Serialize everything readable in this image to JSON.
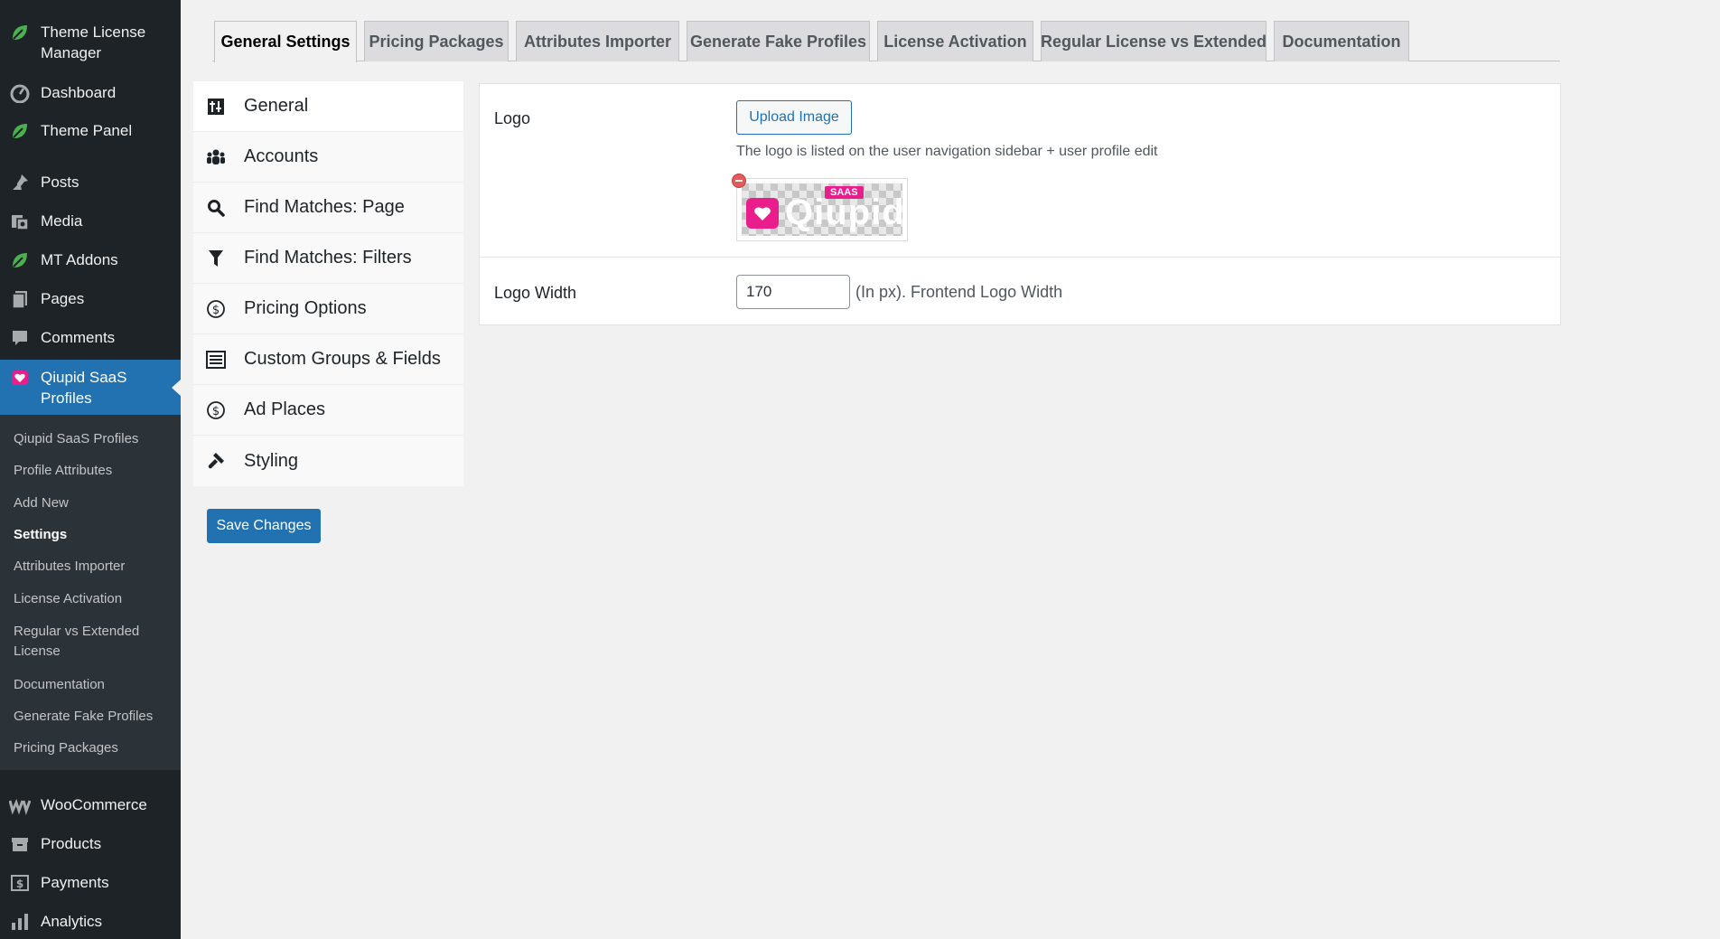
{
  "sidebar": {
    "items": [
      {
        "label": "Theme License Manager",
        "icon": "leaf-icon"
      },
      {
        "label": "Dashboard",
        "icon": "dashboard-icon"
      },
      {
        "label": "Theme Panel",
        "icon": "leaf-icon"
      },
      {
        "label": "Posts",
        "icon": "pin-icon"
      },
      {
        "label": "Media",
        "icon": "media-icon"
      },
      {
        "label": "MT Addons",
        "icon": "leaf-icon"
      },
      {
        "label": "Pages",
        "icon": "pages-icon"
      },
      {
        "label": "Comments",
        "icon": "comment-icon"
      },
      {
        "label": "Qiupid SaaS Profiles",
        "icon": "heart-icon"
      },
      {
        "label": "WooCommerce",
        "icon": "woocommerce-icon"
      },
      {
        "label": "Products",
        "icon": "archive-icon"
      },
      {
        "label": "Payments",
        "icon": "dollar-icon"
      },
      {
        "label": "Analytics",
        "icon": "bar-chart-icon"
      }
    ],
    "submenu": [
      "Qiupid SaaS Profiles",
      "Profile Attributes",
      "Add New",
      "Settings",
      "Attributes Importer",
      "License Activation",
      "Regular vs Extended License",
      "Documentation",
      "Generate Fake Profiles",
      "Pricing Packages"
    ]
  },
  "tabs": [
    "General Settings",
    "Pricing Packages",
    "Attributes Importer",
    "Generate Fake Profiles",
    "License Activation",
    "Regular License vs Extended",
    "Documentation"
  ],
  "sections": [
    {
      "label": "General",
      "icon": "sliders-icon"
    },
    {
      "label": "Accounts",
      "icon": "users-icon"
    },
    {
      "label": "Find Matches: Page",
      "icon": "search-icon"
    },
    {
      "label": "Find Matches: Filters",
      "icon": "filter-icon"
    },
    {
      "label": "Pricing Options",
      "icon": "dollar-circle-icon"
    },
    {
      "label": "Custom Groups & Fields",
      "icon": "list-icon"
    },
    {
      "label": "Ad Places",
      "icon": "dollar-circle-icon"
    },
    {
      "label": "Styling",
      "icon": "brush-icon"
    }
  ],
  "fields": {
    "logo": {
      "label": "Logo",
      "button": "Upload Image",
      "description": "The logo is listed on the user navigation sidebar + user profile edit",
      "preview_word": "Qiupid",
      "preview_badge": "SAAS"
    },
    "logo_width": {
      "label": "Logo Width",
      "value": "170",
      "hint": "(In px). Frontend Logo Width"
    }
  },
  "save_button": "Save Changes",
  "colors": {
    "sidebar_bg": "#1d2327",
    "submenu_bg": "#2c3338",
    "accent": "#2271b1",
    "brand_pink": "#e91e8c"
  }
}
